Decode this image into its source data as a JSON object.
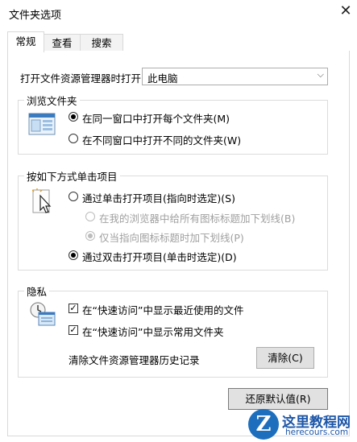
{
  "window": {
    "title": "文件夹选项",
    "close_glyph": "✕"
  },
  "tabs": [
    {
      "label": "常规",
      "active": true
    },
    {
      "label": "查看",
      "active": false
    },
    {
      "label": "搜索",
      "active": false
    }
  ],
  "open_explorer": {
    "label": "打开文件资源管理器时打开:",
    "selected": "此电脑"
  },
  "browse_folders": {
    "title": "浏览文件夹",
    "icon": "folder-window-icon",
    "options": [
      {
        "label": "在同一窗口中打开每个文件夹(M)",
        "selected": true
      },
      {
        "label": "在不同窗口中打开不同的文件夹(W)",
        "selected": false
      }
    ]
  },
  "click_items": {
    "title": "按如下方式单击项目",
    "icon": "cursor-click-icon",
    "single_click": {
      "label": "通过单击打开项目(指向时选定)(S)",
      "selected": false
    },
    "sub_options": [
      {
        "label": "在我的浏览器中给所有图标标题加下划线(B)",
        "selected": false,
        "disabled": true
      },
      {
        "label": "仅当指向图标标题时加下划线(P)",
        "selected": true,
        "disabled": true
      }
    ],
    "double_click": {
      "label": "通过双击打开项目(单击时选定)(D)",
      "selected": true
    }
  },
  "privacy": {
    "title": "隐私",
    "icon": "privacy-clock-icon",
    "checks": [
      {
        "label": "在“快速访问”中显示最近使用的文件",
        "checked": true
      },
      {
        "label": "在“快速访问”中显示常用文件夹",
        "checked": true
      }
    ],
    "clear_label": "清除文件资源管理器历史记录",
    "clear_button": "清除(C)"
  },
  "restore_button": "还原默认值(R)",
  "watermark": {
    "title": "这里教程网",
    "url": "herecours.com",
    "letter": "Z"
  },
  "colors": {
    "accent": "#1e57a8",
    "button_face": "#e1e1e1",
    "border": "#d9d9d9"
  }
}
